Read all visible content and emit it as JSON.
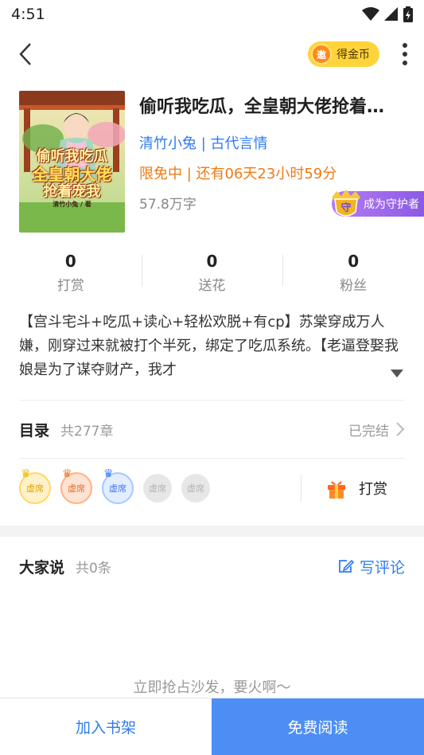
{
  "status_bar": {
    "time": "4:51"
  },
  "nav": {
    "coin_label": "得金币",
    "coin_badge": "邀"
  },
  "book": {
    "title": "偷听我吃瓜，全皇朝大佬抢着宠我",
    "author_category": "清竹小兔 | 古代言情",
    "free_status": "限免中 | 还有06天23小时59分",
    "word_count": "57.8万字",
    "guardian_label": "成为守护者",
    "guardian_shield_char": "守",
    "cover": {
      "title_lines": [
        "偷听我吃瓜",
        "全皇朝大佬",
        "抢着宠我"
      ],
      "author_tag": "清竹小兔 / 著"
    }
  },
  "stats": [
    {
      "value": "0",
      "label": "打赏"
    },
    {
      "value": "0",
      "label": "送花"
    },
    {
      "value": "0",
      "label": "粉丝"
    }
  ],
  "description": "【宫斗宅斗+吃瓜+读心+轻松欢脱+有cp】苏棠穿成万人嫌，刚穿过来就被打个半死，绑定了吃瓜系统。【老逼登娶我娘是为了谋夺财产，我才",
  "catalog": {
    "title": "目录",
    "count": "共277章",
    "status": "已完结"
  },
  "tip_seats": [
    {
      "label": "虚席",
      "tier": "gold"
    },
    {
      "label": "虚席",
      "tier": "bronze"
    },
    {
      "label": "虚席",
      "tier": "silver"
    },
    {
      "label": "虚席",
      "tier": "empty"
    },
    {
      "label": "虚席",
      "tier": "empty"
    }
  ],
  "tip_button": "打赏",
  "comments": {
    "title": "大家说",
    "count": "共0条",
    "write_label": "写评论",
    "empty_text": "立即抢占沙发，要火啊～"
  },
  "bottom": {
    "shelf_label": "加入书架",
    "read_label": "免费阅读"
  },
  "colors": {
    "accent_blue": "#2f7cf0",
    "accent_orange": "#f07a13",
    "read_button": "#4d8ef5"
  }
}
